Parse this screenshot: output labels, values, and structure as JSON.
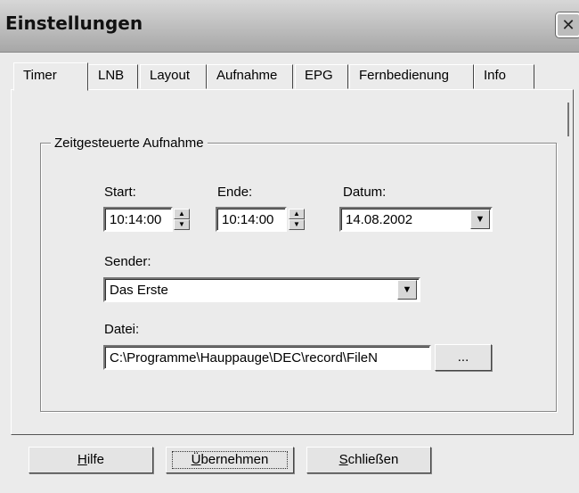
{
  "window": {
    "title": "Einstellungen",
    "close_glyph": "✕"
  },
  "tabs": [
    {
      "label": "Timer"
    },
    {
      "label": "LNB"
    },
    {
      "label": "Layout"
    },
    {
      "label": "Aufnahme"
    },
    {
      "label": "EPG"
    },
    {
      "label": "Fernbedienung"
    },
    {
      "label": "Info"
    }
  ],
  "timer": {
    "group_title": "Zeitgesteuerte Aufnahme",
    "start_label": "Start:",
    "start_value": "10:14:00",
    "end_label": "Ende:",
    "end_value": "10:14:00",
    "date_label": "Datum:",
    "date_value": "14.08.2002",
    "channel_label": "Sender:",
    "channel_value": "Das Erste",
    "file_label": "Datei:",
    "file_value": "C:\\Programme\\Hauppauge\\DEC\\record\\FileN",
    "browse_label": "..."
  },
  "buttons": {
    "help": {
      "mnemonic": "H",
      "rest": "ilfe"
    },
    "apply": {
      "mnemonic": "Ü",
      "rest": "bernehmen"
    },
    "close": {
      "mnemonic": "S",
      "rest": "chließen"
    }
  },
  "icons": {
    "spin_up": "▲",
    "spin_down": "▼",
    "dropdown": "▼"
  }
}
